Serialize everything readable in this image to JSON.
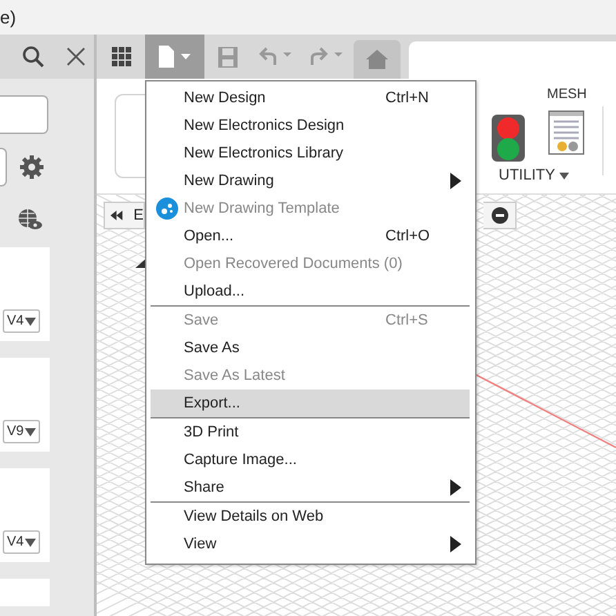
{
  "title_bar": {
    "text": "e)"
  },
  "left_panel": {
    "cards": [
      {
        "version": "V4"
      },
      {
        "version": "V9"
      },
      {
        "version": "V4"
      }
    ]
  },
  "ribbon": {
    "tab": "MESH",
    "group": "UTILITY"
  },
  "nav_bar": {
    "label": "E"
  },
  "file_menu": {
    "items": [
      {
        "kind": "item",
        "label": "New Design",
        "shortcut": "Ctrl+N",
        "disabled": false,
        "selected": false,
        "submenu": false
      },
      {
        "kind": "item",
        "label": "New Electronics Design",
        "disabled": false,
        "selected": false,
        "submenu": false
      },
      {
        "kind": "item",
        "label": "New Electronics Library",
        "disabled": false,
        "selected": false,
        "submenu": false
      },
      {
        "kind": "item",
        "label": "New Drawing",
        "disabled": false,
        "selected": false,
        "submenu": true
      },
      {
        "kind": "icon-item",
        "label": "New Drawing Template",
        "disabled": true,
        "selected": false,
        "submenu": false
      },
      {
        "kind": "item",
        "label": "Open...",
        "shortcut": "Ctrl+O",
        "disabled": false,
        "selected": false,
        "submenu": false
      },
      {
        "kind": "item",
        "label": "Open Recovered Documents (0)",
        "disabled": true,
        "selected": false,
        "submenu": false
      },
      {
        "kind": "item",
        "label": "Upload...",
        "disabled": false,
        "selected": false,
        "submenu": false
      },
      {
        "kind": "separator"
      },
      {
        "kind": "item",
        "label": "Save",
        "shortcut": "Ctrl+S",
        "disabled": true,
        "selected": false,
        "submenu": false
      },
      {
        "kind": "item",
        "label": "Save As",
        "disabled": false,
        "selected": false,
        "submenu": false
      },
      {
        "kind": "item",
        "label": "Save As Latest",
        "disabled": true,
        "selected": false,
        "submenu": false
      },
      {
        "kind": "item",
        "label": "Export...",
        "disabled": false,
        "selected": true,
        "submenu": false
      },
      {
        "kind": "separator"
      },
      {
        "kind": "item",
        "label": "3D Print",
        "disabled": false,
        "selected": false,
        "submenu": false
      },
      {
        "kind": "item",
        "label": "Capture Image...",
        "disabled": false,
        "selected": false,
        "submenu": false
      },
      {
        "kind": "item",
        "label": "Share",
        "disabled": false,
        "selected": false,
        "submenu": true
      },
      {
        "kind": "separator"
      },
      {
        "kind": "item",
        "label": "View Details on Web",
        "disabled": false,
        "selected": false,
        "submenu": false
      },
      {
        "kind": "item",
        "label": "View",
        "disabled": false,
        "selected": false,
        "submenu": true
      }
    ]
  }
}
